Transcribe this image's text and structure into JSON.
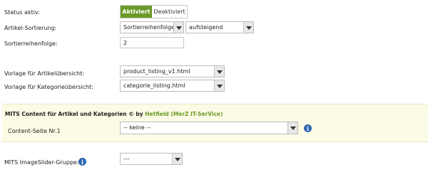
{
  "status": {
    "label": "Status aktiv:",
    "active_label": "Aktiviert",
    "inactive_label": "Deaktiviert"
  },
  "sorting": {
    "label": "Artikel-Sortierung:",
    "field_value": "Sortierreihenfolge",
    "direction_value": "aufsteigend"
  },
  "sort_order": {
    "label": "Sortierreihenfolge:",
    "value": "2"
  },
  "product_template": {
    "label": "Vorlage für Artikelübersicht:",
    "value": "product_listing_v1.html"
  },
  "category_template": {
    "label": "Vorlage für Kategorieübersicht:",
    "value": "categorie_listing.html"
  },
  "content_panel": {
    "title_prefix": "MITS Content für Artikel und Kategorien © by",
    "title_author": "Hetfield (MerZ IT-SerVice)",
    "content_page_label": "Content-Seite Nr.1",
    "content_page_value": "-- keine --"
  },
  "slider": {
    "label": "MITS ImageSlider-Gruppe:",
    "value": "---"
  },
  "icons": {
    "info": "info-icon",
    "dropdown": "chevron-down-icon"
  },
  "colors": {
    "accent_green": "#6b9a28",
    "panel_bg": "#fcfbe5",
    "info_blue": "#2f68b2"
  }
}
